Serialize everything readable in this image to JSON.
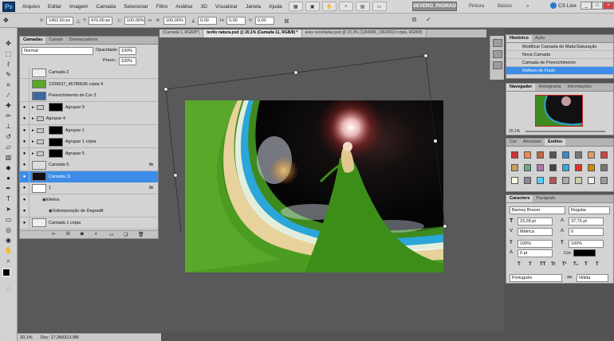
{
  "menubar": {
    "logo": "Ps",
    "items": [
      "Arquivo",
      "Editar",
      "Imagem",
      "Camada",
      "Selecionar",
      "Filtro",
      "Análise",
      "3D",
      "Visualizar",
      "Janela",
      "Ajuda"
    ],
    "workspace": "SEVERO_PADRAO",
    "workspace_links": [
      "Pintura",
      "Básico"
    ],
    "cslive": "CS Live"
  },
  "options": {
    "x": "1452,50 px",
    "y": "470,00 px",
    "w": "100,00%",
    "h": "100,00%",
    "angle": "0,00",
    "hskew": "0,00",
    "vskew": "0,00"
  },
  "doc_tabs": [
    "(Camada 1, RGB/8*)",
    "textlo natura.psd @ 20,1% (Camada 11, RGB/8) *",
    "aves recortadas.psd @ 33,3% (1184088_19639910 cópia, RGB/8)"
  ],
  "layers_panel": {
    "tabs": [
      "Camadas",
      "Canais",
      "Demarcadores"
    ],
    "blend": "Normal",
    "opacity_label": "Opacidade:",
    "opacity": "100%",
    "fill_label": "Preen.:",
    "fill": "100%",
    "rows": [
      {
        "name": "Camada 2",
        "kind": "layer",
        "eye": false
      },
      {
        "name": "1209637_45786636 cópia 4",
        "kind": "layer",
        "eye": false
      },
      {
        "name": "Preenchimento de Cor 3",
        "kind": "fill",
        "eye": false
      },
      {
        "name": "Agrupar 9",
        "kind": "group",
        "eye": true
      },
      {
        "name": "Agrupar 4",
        "kind": "group",
        "eye": true
      },
      {
        "name": "Agrupar 1",
        "kind": "group",
        "eye": true
      },
      {
        "name": "Agrupar 1 cópia",
        "kind": "group",
        "eye": true
      },
      {
        "name": "Agrupar 5",
        "kind": "group",
        "eye": true
      },
      {
        "name": "Camada 5",
        "kind": "layer",
        "eye": true,
        "fx": "fx"
      },
      {
        "name": "Camada 11",
        "kind": "layer",
        "eye": true,
        "sel": true
      },
      {
        "name": "1",
        "kind": "layer",
        "eye": true,
        "fx": "fx"
      },
      {
        "name": "Efeitos",
        "kind": "effect",
        "eye": true
      },
      {
        "name": "Sobreposição de Degradê",
        "kind": "effect",
        "eye": true
      },
      {
        "name": "Camada 1 cópia",
        "kind": "layer",
        "eye": true
      }
    ]
  },
  "history": {
    "tabs": [
      "Histórico",
      "Ação"
    ],
    "rows": [
      "Modificar Camada de Matiz/Saturação",
      "Nova Camada",
      "Camada de Preenchimento",
      "Reflexo de Flash"
    ]
  },
  "navigator": {
    "tabs": [
      "Navegador",
      "Histograma",
      "Informações"
    ],
    "zoom": "20,1%"
  },
  "swatches": {
    "tabs": [
      "Cor",
      "Amostras",
      "Estilos"
    ]
  },
  "character": {
    "tabs": [
      "Caractere",
      "Parágrafo"
    ],
    "font": "Barney Broom",
    "style": "Regular",
    "size": "23,28 pt",
    "leading": "37,75 pt",
    "kerning": "Métrica",
    "tracking": "0",
    "vscale": "100%",
    "hscale": "100%",
    "baseline": "0 pt",
    "color_label": "Cor:",
    "language": "Português",
    "aa": "Nítida",
    "aa_prefix": "aa"
  },
  "status": {
    "zoom": "20,1%",
    "doc": "Doc: 17,2M/313,9M"
  }
}
